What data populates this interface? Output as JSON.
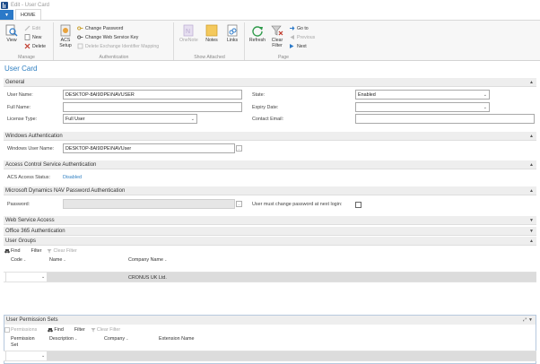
{
  "window": {
    "title": "Edit - User Card"
  },
  "ribbon": {
    "file_button": "▼",
    "tab_home": "HOME",
    "groups": {
      "manage": {
        "label": "Manage",
        "view": "View",
        "edit": "Edit",
        "new": "New",
        "delete": "Delete"
      },
      "authentication": {
        "label": "Authentication",
        "acs_setup_line1": "ACS",
        "acs_setup_line2": "Setup",
        "change_password": "Change Password",
        "change_ws_key": "Change Web Service Key",
        "delete_exchange_id": "Delete Exchange Identifier Mapping"
      },
      "show_attached": {
        "label": "Show Attached",
        "onenote": "OneNote",
        "notes": "Notes",
        "links": "Links"
      },
      "page": {
        "label": "Page",
        "refresh": "Refresh",
        "clear_filter_line1": "Clear",
        "clear_filter_line2": "Filter",
        "go_to": "Go to",
        "previous": "Previous",
        "next": "Next"
      }
    }
  },
  "page_title": "User Card",
  "general": {
    "title": "General",
    "user_name_label": "User Name:",
    "user_name": "DESKTOP-8AI9DPE\\NAVUSER",
    "full_name_label": "Full Name:",
    "full_name": "",
    "license_type_label": "License Type:",
    "license_type": "Full User",
    "state_label": "State:",
    "state": "Enabled",
    "expiry_date_label": "Expiry Date:",
    "expiry_date": "",
    "contact_email_label": "Contact Email:",
    "contact_email": ""
  },
  "windows_auth": {
    "title": "Windows Authentication",
    "windows_user_name_label": "Windows User Name:",
    "windows_user_name": "DESKTOP-8AI9DPE\\NAVUser",
    "assist": "..."
  },
  "acs_auth": {
    "title": "Access Control Service Authentication",
    "status_label": "ACS Access Status:",
    "status": "Disabled"
  },
  "nav_password_auth": {
    "title": "Microsoft Dynamics NAV Password Authentication",
    "password_label": "Password:",
    "password": "",
    "assist": "...",
    "must_change_label": "User must change password at next login:"
  },
  "web_service_access": {
    "title": "Web Service Access"
  },
  "office365_auth": {
    "title": "Office 365 Authentication"
  },
  "user_groups": {
    "title": "User Groups",
    "toolbar": {
      "find": "Find",
      "filter": "Filter",
      "clear_filter": "Clear Filter"
    },
    "columns": {
      "code": "Code",
      "name": "Name",
      "company_name": "Company Name"
    },
    "rows": [
      {
        "code": "",
        "name": "",
        "company_name": "CRONUS UK Ltd."
      }
    ]
  },
  "user_permission_sets": {
    "title": "User Permission Sets",
    "toolbar": {
      "permissions": "Permissions",
      "find": "Find",
      "filter": "Filter",
      "clear_filter": "Clear Filter"
    },
    "columns": {
      "permission_set_line1": "Permission",
      "permission_set_line2": "Set",
      "description": "Description",
      "company": "Company",
      "extension_name": "Extension Name"
    }
  },
  "colors": {
    "accent": "#2f7fc1",
    "file_button": "#2b79c8",
    "section_bg": "#eeeeee"
  }
}
